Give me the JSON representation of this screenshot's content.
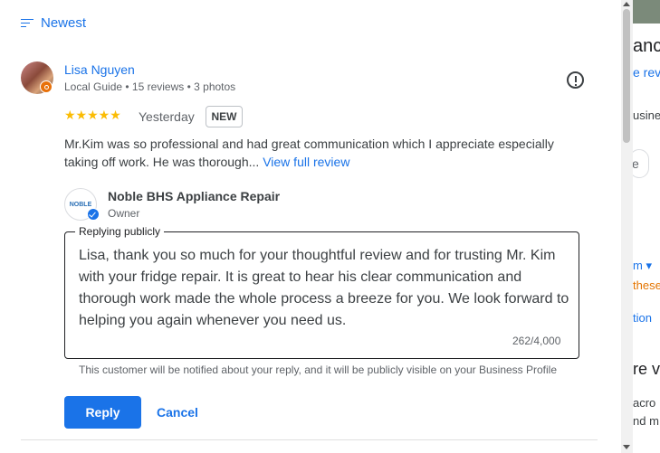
{
  "sort": {
    "label": "Newest",
    "icon": "sort-icon"
  },
  "review": {
    "reviewer_name": "Lisa Nguyen",
    "reviewer_meta": "Local Guide • 15 reviews • 3 photos",
    "stars": "★★★★★",
    "rating": 5,
    "date": "Yesterday",
    "badge": "NEW",
    "text": "Mr.Kim was so professional and had great communication which I appreciate especially taking off work. He was thorough...",
    "more_link": "View full review"
  },
  "business": {
    "logo_text": "NOBLE",
    "name": "Noble BHS Appliance Repair",
    "role": "Owner"
  },
  "reply": {
    "legend": "Replying publicly",
    "text": "Lisa, thank you so much for your thoughtful review and for trusting Mr. Kim with your fridge repair. It is great to hear his clear communication and thorough work made the whole process a breeze for you. We look forward to helping you again whenever you need us.",
    "char_count": "262/4,000",
    "notice": "This customer will be notified about your reply, and it will be publicly visible on your Business Profile",
    "reply_label": "Reply",
    "cancel_label": "Cancel"
  },
  "background": {
    "fragments": [
      "anc",
      "e rev",
      "usine",
      "e",
      "m ▾",
      "these",
      "tion",
      "re v",
      "acro",
      "nd m"
    ]
  },
  "colors": {
    "accent": "#1a73e8",
    "star": "#fbbc04",
    "local_guide_badge": "#e8710a"
  }
}
